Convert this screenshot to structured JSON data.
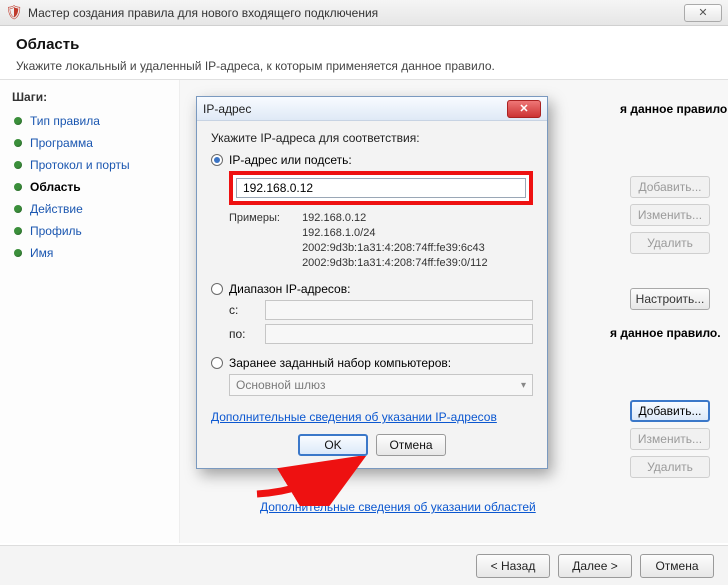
{
  "window": {
    "title": "Мастер создания правила для нового входящего подключения",
    "close_glyph": "✕"
  },
  "header": {
    "title": "Область",
    "subtitle": "Укажите локальный и удаленный IP-адреса, к которым применяется данное правило."
  },
  "sidebar": {
    "title": "Шаги:",
    "steps": [
      "Тип правила",
      "Программа",
      "Протокол и порты",
      "Область",
      "Действие",
      "Профиль",
      "Имя"
    ],
    "active_index": 3
  },
  "main": {
    "rule_text": "я данное правило.",
    "rule_text2": "я данное правило.",
    "buttons": {
      "add": "Добавить...",
      "edit": "Изменить...",
      "delete": "Удалить",
      "configure": "Настроить..."
    },
    "scope_link": "Дополнительные сведения об указании областей"
  },
  "footer": {
    "back": "< Назад",
    "next": "Далее >",
    "cancel": "Отмена"
  },
  "dialog": {
    "title": "IP-адрес",
    "close_glyph": "✕",
    "instruction": "Укажите IP-адреса для соответствия:",
    "radio_ip_label": "IP-адрес или подсеть:",
    "ip_value": "192.168.0.12",
    "examples_label": "Примеры:",
    "examples": [
      "192.168.0.12",
      "192.168.1.0/24",
      "2002:9d3b:1a31:4:208:74ff:fe39:6c43",
      "2002:9d3b:1a31:4:208:74ff:fe39:0/112"
    ],
    "radio_range_label": "Диапазон IP-адресов:",
    "range_from_label": "с:",
    "range_to_label": "по:",
    "radio_predef_label": "Заранее заданный набор компьютеров:",
    "predef_value": "Основной шлюз",
    "more_link": "Дополнительные сведения об указании IP-адресов",
    "ok": "OK",
    "cancel": "Отмена"
  }
}
